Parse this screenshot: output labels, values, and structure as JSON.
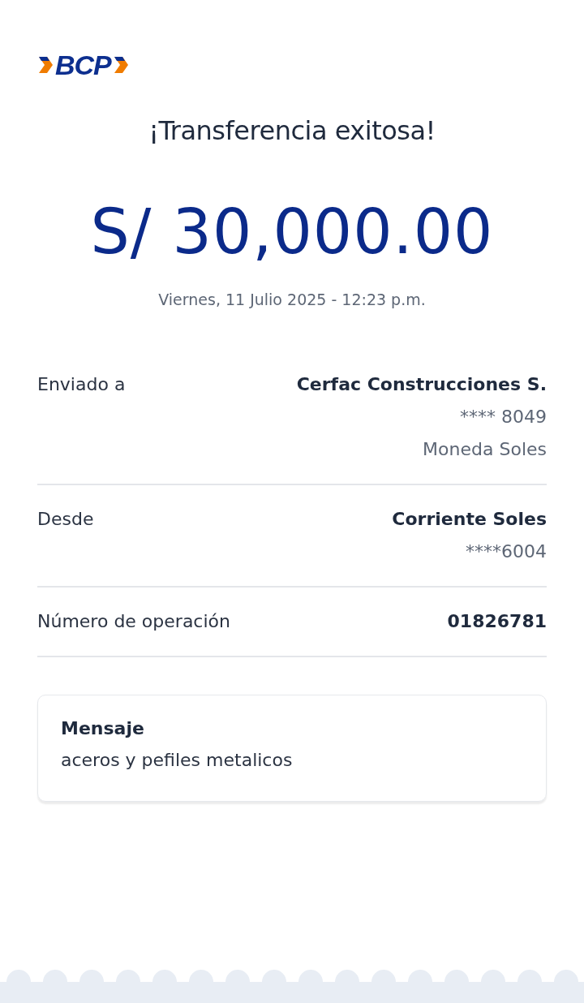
{
  "logo": {
    "text": "BCP"
  },
  "title": "¡Transferencia exitosa!",
  "amount": "S/ 30,000.00",
  "date": "Viernes, 11 Julio 2025 - 12:23 p.m.",
  "details": [
    {
      "label": "Enviado a",
      "values": [
        {
          "text": "Cerfac Construcciones S.",
          "kind": "strong"
        },
        {
          "text": "**** 8049",
          "kind": "muted"
        },
        {
          "text": "Moneda Soles",
          "kind": "muted"
        }
      ]
    },
    {
      "label": "Desde",
      "values": [
        {
          "text": "Corriente Soles",
          "kind": "strong"
        },
        {
          "text": "****6004",
          "kind": "muted"
        }
      ]
    },
    {
      "label": "Número de operación",
      "values": [
        {
          "text": "01826781",
          "kind": "strong"
        }
      ]
    }
  ],
  "message": {
    "title": "Mensaje",
    "text": "aceros y pefiles metalicos"
  }
}
